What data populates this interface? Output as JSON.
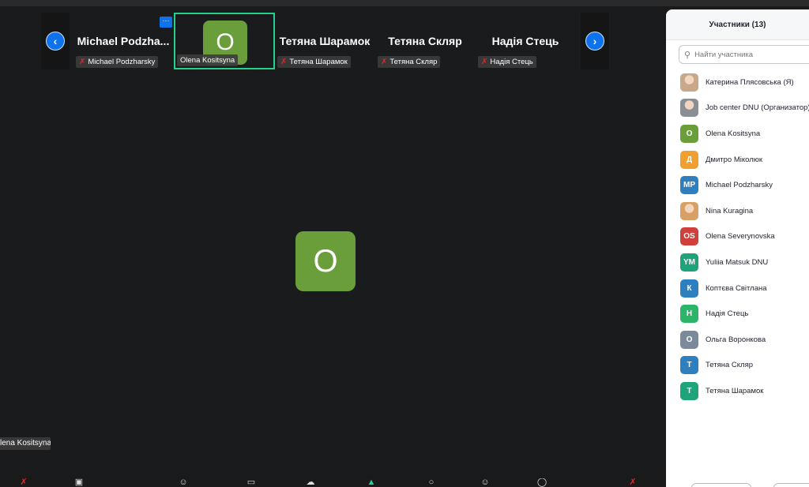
{
  "gallery": {
    "prev_icon": "chevron-left-icon",
    "next_icon": "chevron-right-icon",
    "more_label": "···",
    "tiles": [
      {
        "display_name": "Michael  Podzha...",
        "label": "Michael Podzharsky",
        "muted": true
      },
      {
        "display_name": "",
        "label": "Olena Kositsyna",
        "avatar": "O",
        "active": true,
        "muted": false
      },
      {
        "display_name": "Тетяна Шарамок",
        "label": "Тетяна Шарамок",
        "muted": true
      },
      {
        "display_name": "Тетяна Скляр",
        "label": "Тетяна Скляр",
        "muted": true
      },
      {
        "display_name": "Надія Стець",
        "label": "Надія Стець",
        "muted": true
      }
    ]
  },
  "speaker": {
    "avatar": "O",
    "label": "Olena Kositsyna",
    "label_visible": "lena Kositsyna"
  },
  "participants_panel": {
    "title": "Участники (13)",
    "search_placeholder": "Найти участника",
    "participants": [
      {
        "name": "Катерина Плясовська (Я)",
        "avatar": "",
        "color": "#c9a88a",
        "photo": true
      },
      {
        "name": "Job center DNU (Организатор)",
        "avatar": "",
        "color": "#8a8f96",
        "photo": true
      },
      {
        "name": "Olena Kositsyna",
        "avatar": "O",
        "color": "#6a9e3a"
      },
      {
        "name": "Дмитро Міколюк",
        "avatar": "Д",
        "color": "#f0a030"
      },
      {
        "name": "Michael Podzharsky",
        "avatar": "MP",
        "color": "#2d7fbf"
      },
      {
        "name": "Nina Kuragina",
        "avatar": "",
        "color": "#d9a066",
        "photo": true
      },
      {
        "name": "Olena Severynovska",
        "avatar": "OS",
        "color": "#d0403a"
      },
      {
        "name": "Yuliia Matsuk DNU",
        "avatar": "YM",
        "color": "#1fa37a"
      },
      {
        "name": "Коптєва Світлана",
        "avatar": "К",
        "color": "#2d7fbf"
      },
      {
        "name": "Надія Стець",
        "avatar": "Н",
        "color": "#2cb56a"
      },
      {
        "name": "Ольга Воронкова",
        "avatar": "О",
        "color": "#7a8a9a"
      },
      {
        "name": "Тетяна Скляр",
        "avatar": "Т",
        "color": "#2d7fbf"
      },
      {
        "name": "Тетяна Шарамок",
        "avatar": "Т",
        "color": "#1fa37a"
      }
    ]
  },
  "toolbar": {
    "icons": [
      "microphone-muted-icon",
      "video-off-icon",
      "participants-icon",
      "security-icon",
      "chat-icon",
      "share-screen-icon",
      "record-icon",
      "reactions-icon",
      "apps-icon",
      "more-icon",
      "leave-icon"
    ]
  },
  "colors": {
    "accent": "#0e72ed",
    "active_border": "#23d18b",
    "muted": "#e02828"
  }
}
